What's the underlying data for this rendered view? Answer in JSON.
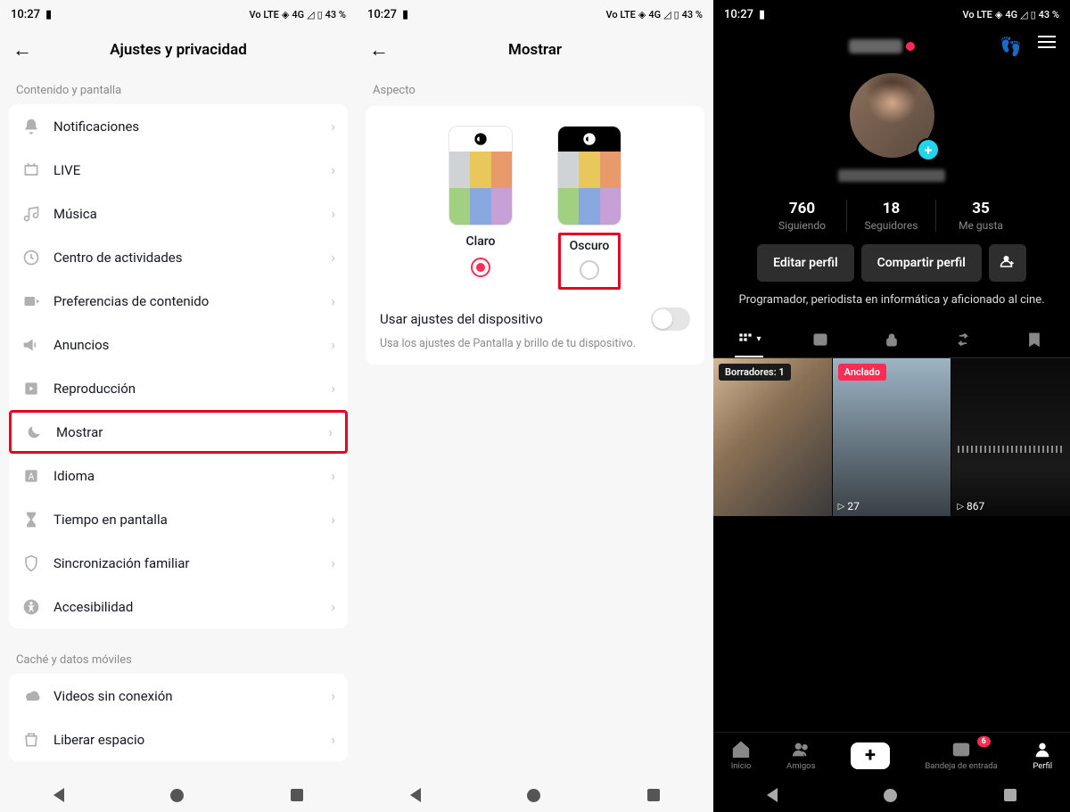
{
  "status": {
    "time": "10:27",
    "network": "Vo LTE",
    "signal": "4G",
    "battery": "43 %"
  },
  "s1": {
    "title": "Ajustes y privacidad",
    "section1": "Contenido y pantalla",
    "items1": [
      {
        "label": "Notificaciones"
      },
      {
        "label": "LIVE"
      },
      {
        "label": "Música"
      },
      {
        "label": "Centro de actividades"
      },
      {
        "label": "Preferencias de contenido"
      },
      {
        "label": "Anuncios"
      },
      {
        "label": "Reproducción"
      },
      {
        "label": "Mostrar"
      },
      {
        "label": "Idioma"
      },
      {
        "label": "Tiempo en pantalla"
      },
      {
        "label": "Sincronización familiar"
      },
      {
        "label": "Accesibilidad"
      }
    ],
    "section2": "Caché y datos móviles",
    "items2": [
      {
        "label": "Videos sin conexión"
      },
      {
        "label": "Liberar espacio"
      }
    ]
  },
  "s2": {
    "title": "Mostrar",
    "aspect": "Aspecto",
    "light": "Claro",
    "dark": "Oscuro",
    "device_label": "Usar ajustes del dispositivo",
    "device_desc": "Usa los ajustes de Pantalla y brillo de tu dispositivo."
  },
  "s3": {
    "stats": {
      "following_n": "760",
      "following_l": "Siguiendo",
      "followers_n": "18",
      "followers_l": "Seguidores",
      "likes_n": "35",
      "likes_l": "Me gusta"
    },
    "edit": "Editar perfil",
    "share": "Compartir perfil",
    "bio": "Programador, periodista en informática y aficionado al cine.",
    "drafts": "Borradores: 1",
    "pinned": "Anclado",
    "views2": "27",
    "views3": "867",
    "nav": {
      "home": "Inicio",
      "friends": "Amigos",
      "inbox": "Bandeja de entrada",
      "profile": "Perfil",
      "badge": "6"
    }
  }
}
